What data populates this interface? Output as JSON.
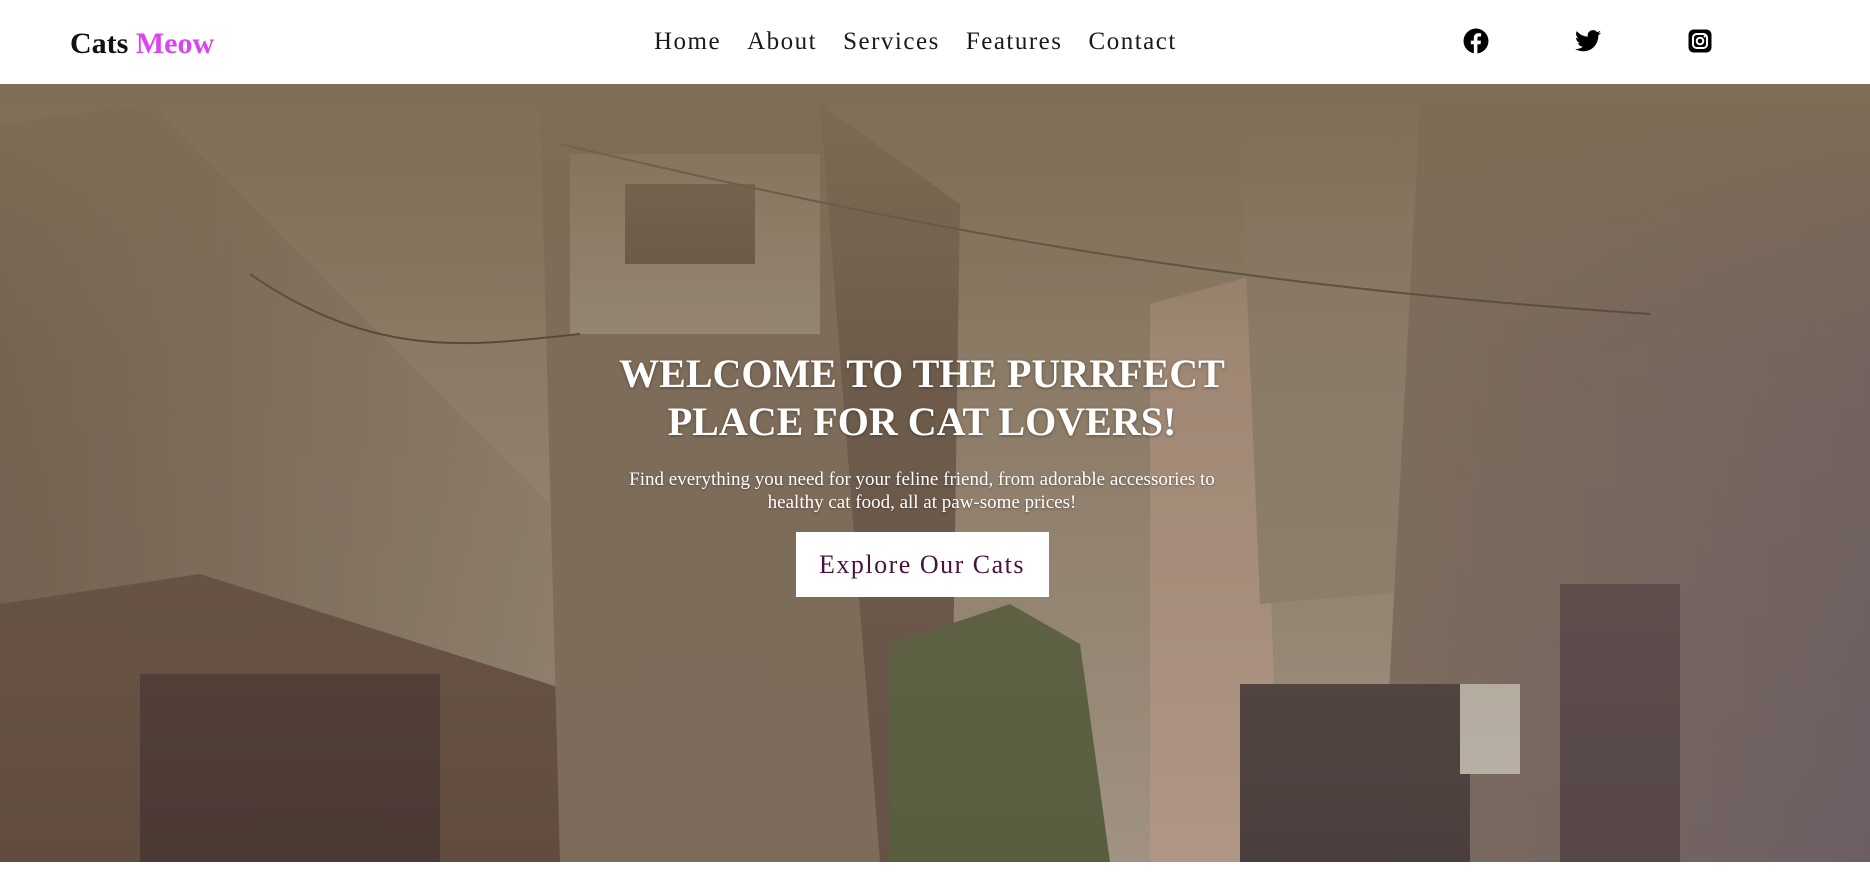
{
  "brand": {
    "name": "Cats",
    "accent": "Meow",
    "accent_color": "#d946ef"
  },
  "nav": {
    "items": [
      {
        "label": "Home"
      },
      {
        "label": "About"
      },
      {
        "label": "Services"
      },
      {
        "label": "Features"
      },
      {
        "label": "Contact"
      }
    ]
  },
  "social": [
    {
      "icon": "facebook-icon"
    },
    {
      "icon": "twitter-icon"
    },
    {
      "icon": "instagram-icon"
    }
  ],
  "hero": {
    "title": "WELCOME TO THE PURRFECT PLACE FOR CAT LOVERS!",
    "subtitle": "Find everything you need for your feline friend, from adorable accessories to healthy cat food, all at paw-some prices!",
    "button_label": "Explore Our Cats",
    "button_text_color": "#4a1040"
  }
}
